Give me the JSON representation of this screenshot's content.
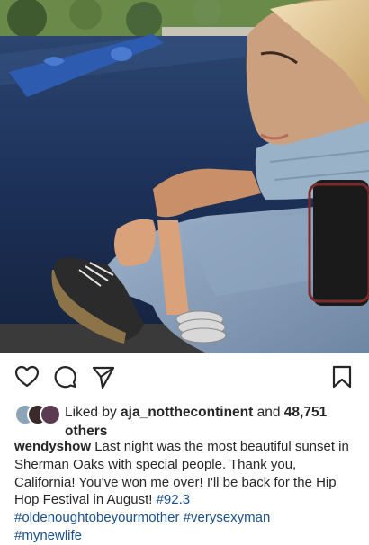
{
  "post": {
    "liked_prefix": "Liked by ",
    "liked_user": "aja_notthecontinent",
    "liked_and": " and ",
    "likes_count": "48,751",
    "likes_suffix": "others",
    "caption_user": "wendyshow",
    "caption_text": "Last night was the most beautiful sunset in Sherman Oaks with special people. Thank you, California! You've won me over! I'll be back for the Hip Hop Festival in August!",
    "hashtags": [
      "#92.3",
      "#oldenoughtobeyourmother",
      "#verysexyman",
      "#mynewlife"
    ]
  },
  "icons": {
    "like": "heart-icon",
    "comment": "comment-icon",
    "share": "paper-plane-icon",
    "save": "bookmark-icon"
  },
  "colors": {
    "text": "#262626",
    "hashtag": "#1b4f8a",
    "pool_water": "#1c2e4d"
  }
}
